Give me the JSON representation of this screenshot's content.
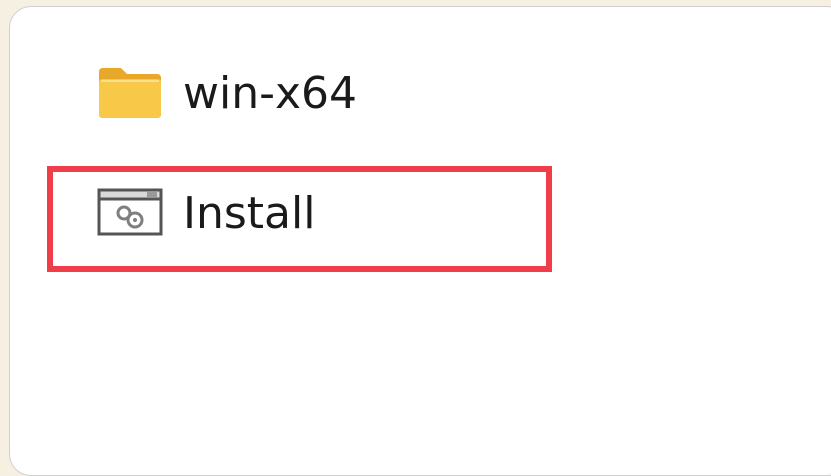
{
  "files": [
    {
      "name": "win-x64",
      "icon": "folder-icon"
    },
    {
      "name": "Install",
      "icon": "executable-icon"
    }
  ],
  "highlight": {
    "target": "Install",
    "color": "#ef3e49"
  },
  "colors": {
    "background": "#f5f0e1",
    "folder": "#f5c343",
    "text": "#1a1a1a"
  }
}
